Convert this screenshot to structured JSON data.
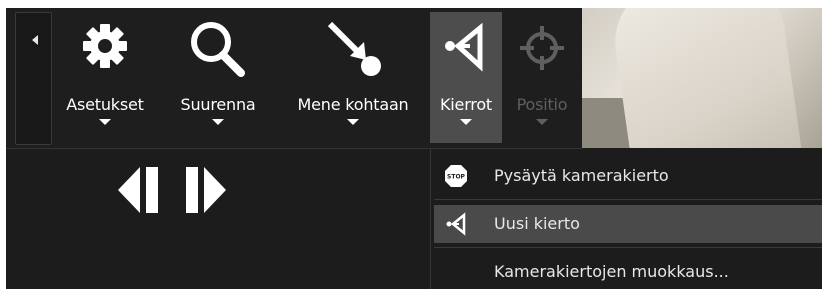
{
  "toolbar": {
    "collapse_icon": "triangle-left-icon",
    "tools": [
      {
        "label": "Asetukset",
        "icon": "gear-icon"
      },
      {
        "label": "Suurenna",
        "icon": "magnifier-icon"
      },
      {
        "label": "Mene kohtaan",
        "icon": "goto-arrow-icon"
      },
      {
        "label": "Kierrot",
        "icon": "tour-icon",
        "active": true
      },
      {
        "label": "Positio",
        "icon": "crosshair-icon",
        "disabled": true
      }
    ]
  },
  "playback": {
    "prev_icon": "step-back-icon",
    "next_icon": "step-forward-icon"
  },
  "menu": {
    "items": [
      {
        "label": "Pysäytä kamerakierto",
        "icon": "stop-sign-icon",
        "icon_text": "STOP"
      },
      {
        "label": "Uusi kierto",
        "icon": "tour-icon",
        "highlighted": true
      },
      {
        "label": "Kamerakiertojen muokkaus..."
      }
    ]
  },
  "colors": {
    "background": "#1c1c1c",
    "active_tool": "#4d4d4d",
    "highlight": "#4a4a4a",
    "text": "#ffffff",
    "disabled_text": "#5f5f5f"
  }
}
